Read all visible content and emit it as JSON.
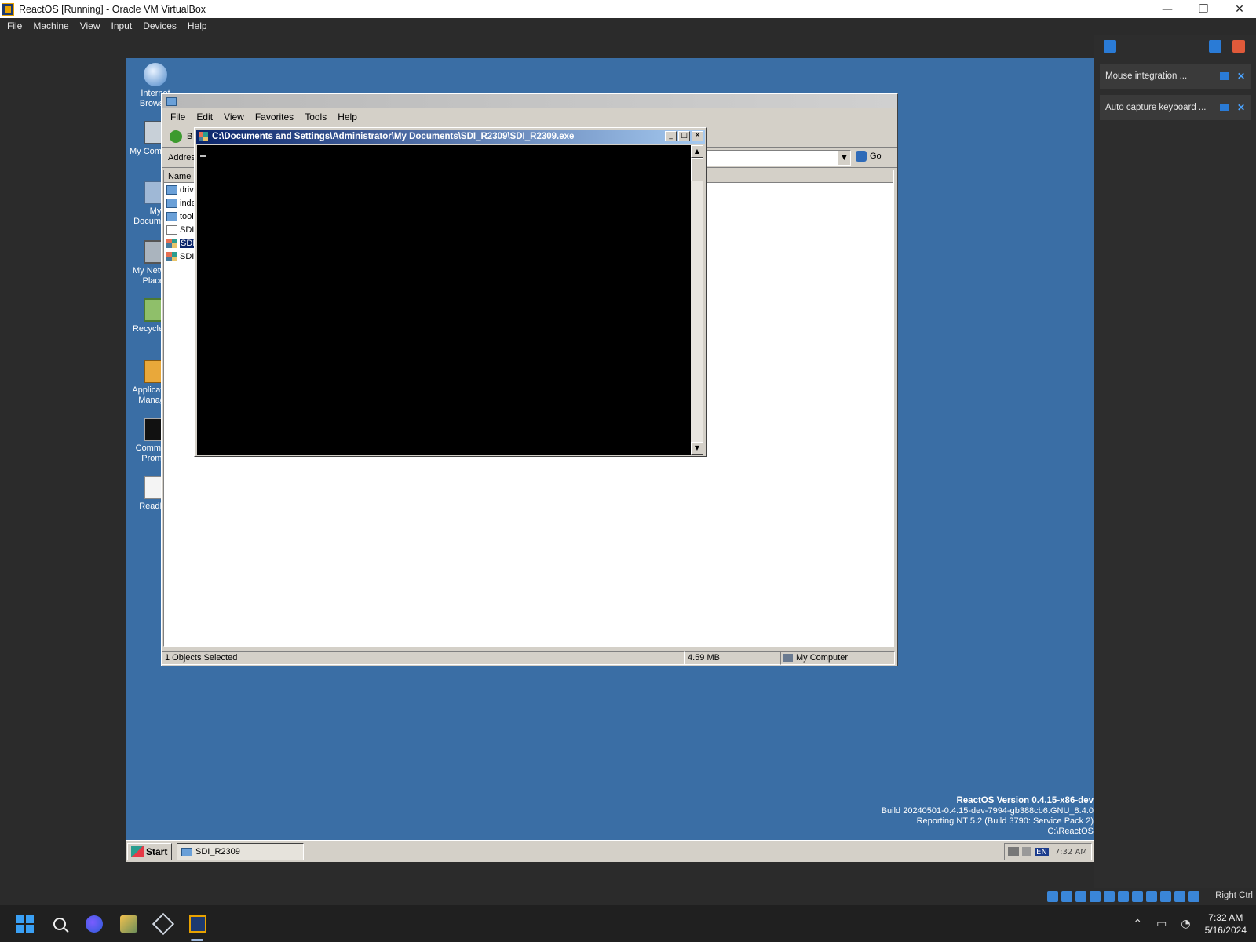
{
  "host": {
    "title": "ReactOS [Running] - Oracle VM VirtualBox",
    "controls": {
      "minimize": "—",
      "restore": "❐",
      "close": "✕"
    },
    "menu": [
      "File",
      "Machine",
      "View",
      "Input",
      "Devices",
      "Help"
    ]
  },
  "desktop": {
    "icons": [
      "Internet Browser",
      "My Computer",
      "My Documents",
      "My Network Places",
      "Recycle Bin",
      "Applications Manager",
      "Command Prompt",
      "ReadMe"
    ]
  },
  "explorer": {
    "menu": [
      "File",
      "Edit",
      "View",
      "Favorites",
      "Tools",
      "Help"
    ],
    "back_label": "B",
    "address_label": "Addres",
    "go_label": "Go",
    "column_name": "Name",
    "files": [
      {
        "name": "driv",
        "type": "folder",
        "selected": false
      },
      {
        "name": "inde",
        "type": "folder",
        "selected": false
      },
      {
        "name": "tool",
        "type": "folder",
        "selected": false
      },
      {
        "name": "SDI",
        "type": "doc",
        "selected": false
      },
      {
        "name": "SDI",
        "type": "exe",
        "selected": true
      },
      {
        "name": "SDI",
        "type": "exe",
        "selected": false
      }
    ],
    "status": {
      "selected": "1 Objects Selected",
      "size": "4.59 MB",
      "location": "My Computer"
    }
  },
  "console": {
    "title": "C:\\Documents and Settings\\Administrator\\My Documents\\SDI_R2309\\SDI_R2309.exe"
  },
  "guest_taskbar": {
    "start": "Start",
    "task": "SDI_R2309",
    "lang": "EN",
    "clock": "7:32 AM"
  },
  "os_info": {
    "line1": "ReactOS Version 0.4.15-x86-dev",
    "line2": "Build 20240501-0.4.15-dev-7994-gb388cb6.GNU_8.4.0",
    "line3": "Reporting NT 5.2 (Build 3790: Service Pack 2)",
    "line4": "C:\\ReactOS"
  },
  "notifications": [
    {
      "text": "Mouse integration ..."
    },
    {
      "text": "Auto capture keyboard ..."
    }
  ],
  "host_status": {
    "host_key": "Right Ctrl"
  },
  "win_taskbar": {
    "time": "7:32 AM",
    "date": "5/16/2024"
  },
  "colors": {
    "guest_desktop": "#3a6ea5",
    "console_title": "#0a246a",
    "vbox_accent": "#2a7bd6"
  }
}
